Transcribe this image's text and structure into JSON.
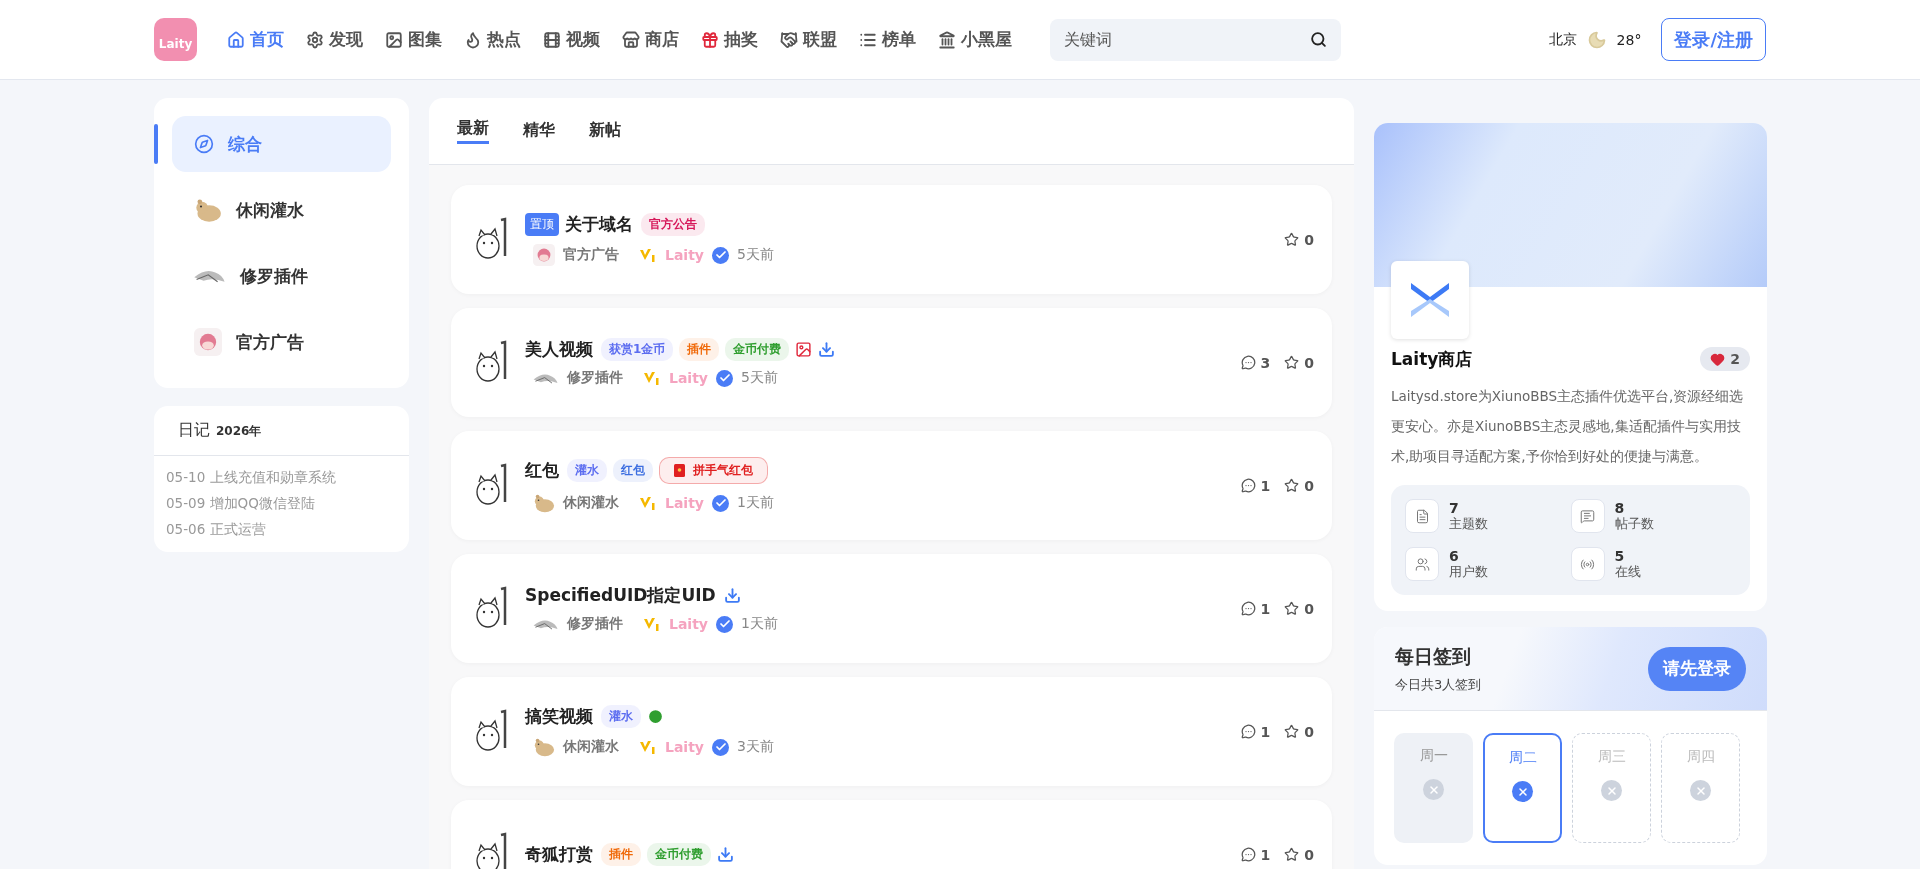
{
  "header": {
    "logo": "Laity",
    "nav": [
      {
        "label": "首页",
        "kind": "home",
        "selected": true
      },
      {
        "label": "发现",
        "kind": "gear",
        "selected": false
      },
      {
        "label": "图集",
        "kind": "image",
        "selected": false
      },
      {
        "label": "热点",
        "kind": "flame",
        "selected": false
      },
      {
        "label": "视频",
        "kind": "film",
        "selected": false
      },
      {
        "label": "商店",
        "kind": "store",
        "selected": false
      },
      {
        "label": "抽奖",
        "kind": "gift",
        "selected": false
      },
      {
        "label": "联盟",
        "kind": "handshake",
        "selected": false
      },
      {
        "label": "榜单",
        "kind": "list",
        "selected": false
      },
      {
        "label": "小黑屋",
        "kind": "bank",
        "selected": false
      }
    ],
    "search": {
      "placeholder": "关键词"
    },
    "weather": {
      "city": "北京",
      "temperature": "28°"
    },
    "login": "登录/注册"
  },
  "forums": [
    {
      "label": "综合",
      "kind": "compass",
      "selected": true
    },
    {
      "label": "休闲灌水",
      "kind": "hamster",
      "selected": false
    },
    {
      "label": "修罗插件",
      "kind": "bird",
      "selected": false
    },
    {
      "label": "官方广告",
      "kind": "girl",
      "selected": false
    }
  ],
  "diary": {
    "title": "日记",
    "year": "2026年",
    "entries": [
      {
        "date": "05-10",
        "text": "上线充值和勋章系统"
      },
      {
        "date": "05-09",
        "text": "增加QQ微信登陆"
      },
      {
        "date": "05-06",
        "text": "正式运营"
      }
    ]
  },
  "tabs": [
    {
      "label": "最新",
      "selected": true
    },
    {
      "label": "精华",
      "selected": false
    },
    {
      "label": "新帖",
      "selected": false
    }
  ],
  "posts": [
    {
      "pinned": "置顶",
      "title": "关于域名",
      "tags": [
        {
          "label": "官方公告",
          "color": "#d6185a",
          "kind": "tag"
        }
      ],
      "forum": {
        "name": "官方广告",
        "kind": "girl"
      },
      "author": "Laity",
      "time": "5天前",
      "stars": "0"
    },
    {
      "title": "美人视频",
      "tags": [
        {
          "label": "获赏1金币",
          "color": "#5b6cf0",
          "kind": "tag"
        },
        {
          "label": "插件",
          "color": "#f06a0a",
          "kind": "tag"
        },
        {
          "label": "金币付费",
          "color": "#2f9e2f",
          "kind": "tag"
        }
      ],
      "attachments": [
        {
          "kind": "image"
        },
        {
          "kind": "download"
        }
      ],
      "forum": {
        "name": "修罗插件",
        "kind": "bird"
      },
      "author": "Laity",
      "time": "5天前",
      "comments": "3",
      "stars": "0"
    },
    {
      "title": "红包",
      "tags": [
        {
          "label": "灌水",
          "color": "#5b6cf0",
          "kind": "tag"
        },
        {
          "label": "红包",
          "color": "#3d6fe0",
          "kind": "tag"
        },
        {
          "label": "拼手气红包",
          "color": "#e02020",
          "kind": "lucky-money"
        }
      ],
      "forum": {
        "name": "休闲灌水",
        "kind": "hamster"
      },
      "author": "Laity",
      "time": "1天前",
      "comments": "1",
      "stars": "0"
    },
    {
      "title": "SpecifiedUID指定UID",
      "attachments": [
        {
          "kind": "download"
        }
      ],
      "forum": {
        "name": "修罗插件",
        "kind": "bird"
      },
      "author": "Laity",
      "time": "1天前",
      "comments": "1",
      "stars": "0"
    },
    {
      "title": "搞笑视频",
      "tags": [
        {
          "label": "灌水",
          "color": "#5b6cf0",
          "kind": "tag"
        }
      ],
      "attachments": [
        {
          "kind": "video"
        }
      ],
      "forum": {
        "name": "休闲灌水",
        "kind": "hamster"
      },
      "author": "Laity",
      "time": "3天前",
      "comments": "1",
      "stars": "0"
    },
    {
      "title": "奇狐打赏",
      "tags": [
        {
          "label": "插件",
          "color": "#f06a0a",
          "kind": "tag"
        },
        {
          "label": "金币付费",
          "color": "#2f9e2f",
          "kind": "tag"
        }
      ],
      "attachments": [
        {
          "kind": "download"
        }
      ],
      "comments": "1",
      "stars": "0"
    }
  ],
  "store": {
    "name": "Laity商店",
    "likes": "2",
    "description": "Laitysd.store为XiunoBBS主态插件优选平台,资源经细选更安心。亦是XiunoBBS主态灵感地,集适配插件与实用技术,助项目寻适配方案,予你恰到好处的便捷与满意。",
    "stats": [
      {
        "value": "7",
        "label": "主题数",
        "kind": "file"
      },
      {
        "value": "8",
        "label": "帖子数",
        "kind": "message"
      },
      {
        "value": "6",
        "label": "用户数",
        "kind": "users"
      },
      {
        "value": "5",
        "label": "在线",
        "kind": "signal"
      }
    ]
  },
  "checkin": {
    "title": "每日签到",
    "subtitle": "今日共3人签到",
    "button": "请先登录",
    "days": [
      {
        "label": "周一",
        "kind": "past"
      },
      {
        "label": "周二",
        "kind": "today"
      },
      {
        "label": "周三",
        "kind": "future"
      },
      {
        "label": "周四",
        "kind": "future"
      }
    ]
  }
}
